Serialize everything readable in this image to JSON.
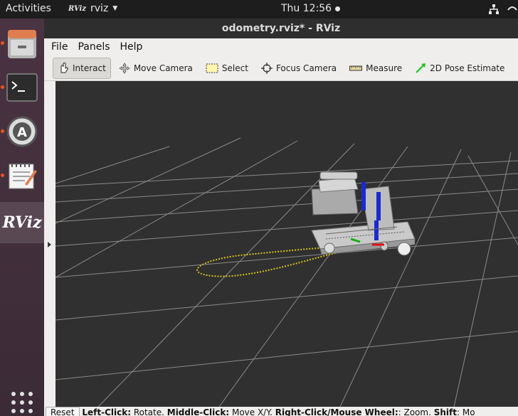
{
  "topbar": {
    "activities": "Activities",
    "app_name": "rviz",
    "app_icon_text": "RViz",
    "clock": "Thu 12:56"
  },
  "dock": {
    "items": [
      {
        "name": "files",
        "active": false
      },
      {
        "name": "terminal",
        "active": false
      },
      {
        "name": "software-updater",
        "active": false
      },
      {
        "name": "text-editor",
        "active": false
      },
      {
        "name": "rviz",
        "label": "RViz",
        "active": true
      }
    ]
  },
  "window": {
    "title": "odometry.rviz* - RViz"
  },
  "menu": {
    "file": "File",
    "panels": "Panels",
    "help": "Help"
  },
  "toolbar": {
    "interact": "Interact",
    "move_camera": "Move Camera",
    "select": "Select",
    "focus_camera": "Focus Camera",
    "measure": "Measure",
    "pose_estimate": "2D Pose Estimate"
  },
  "status": {
    "reset": "Reset",
    "left_click": "Left-Click:",
    "left_action": " Rotate. ",
    "middle_click": "Middle-Click:",
    "middle_action": " Move X/Y. ",
    "right_click": "Right-Click/Mouse Wheel:",
    "right_action": ": Zoom. ",
    "shift": "Shift",
    "shift_action": ": Mo"
  },
  "colors": {
    "grid": "#8a8a8a",
    "background": "#303030",
    "odometry_path": "#d4c21a",
    "accent": "#e95420"
  }
}
